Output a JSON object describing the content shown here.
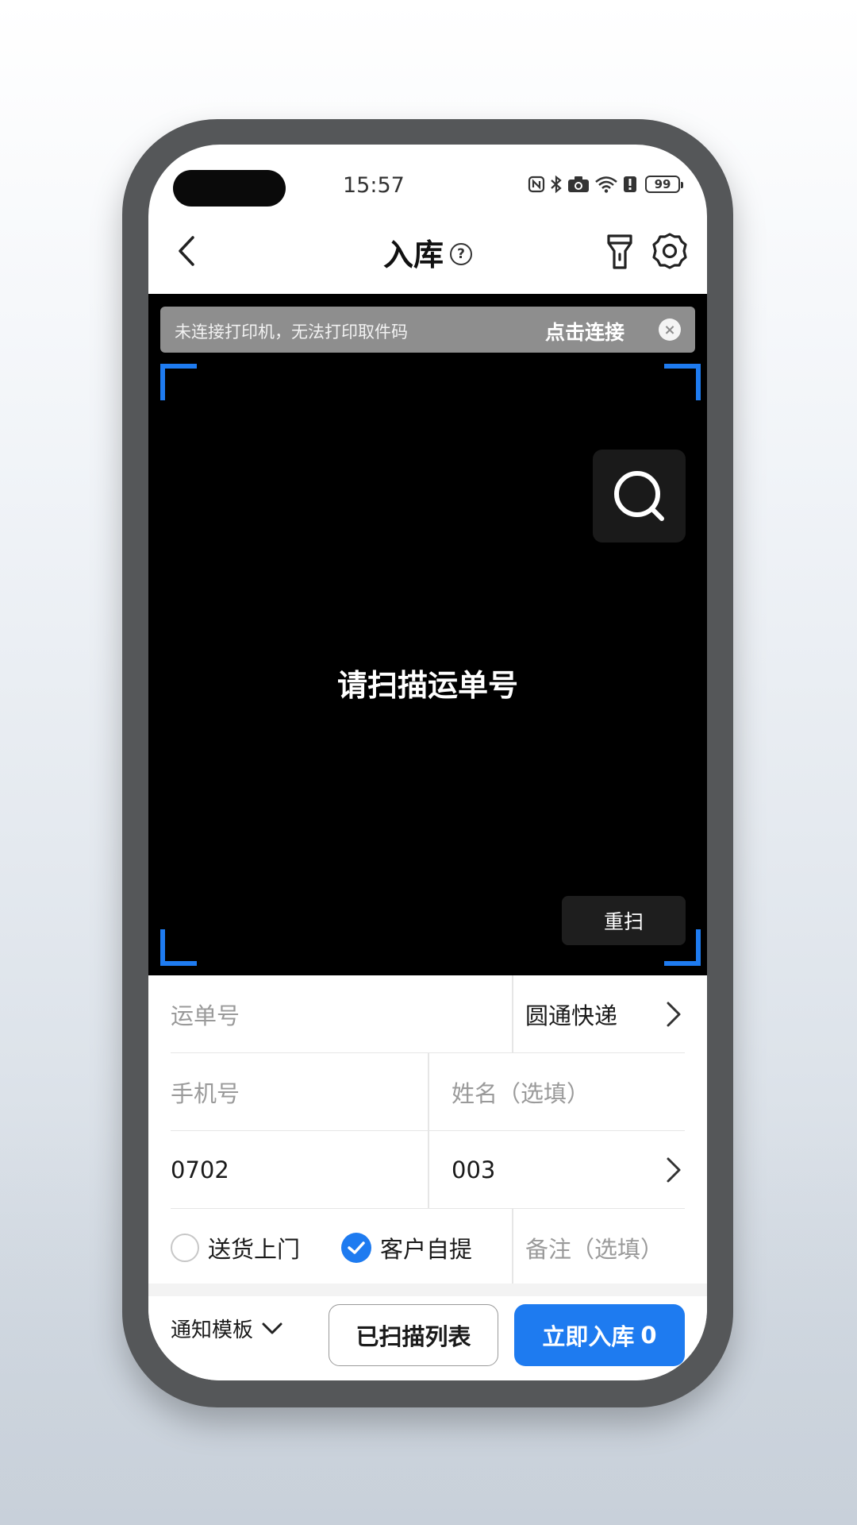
{
  "status_bar": {
    "time": "15:57",
    "battery": "99"
  },
  "nav": {
    "title": "入库",
    "help_glyph": "?"
  },
  "banner": {
    "message": "未连接打印机，无法打印取件码",
    "connect_label": "点击连接",
    "close_glyph": "×"
  },
  "scanner": {
    "prompt": "请扫描运单号",
    "rescan_label": "重扫"
  },
  "form": {
    "tracking_placeholder": "运单号",
    "courier": "圆通快递",
    "phone_placeholder": "手机号",
    "name_placeholder": "姓名（选填）",
    "phone_suffix": "0702",
    "code": "003",
    "delivery_options": [
      {
        "label": "送货上门",
        "checked": false
      },
      {
        "label": "客户自提",
        "checked": true
      }
    ],
    "remark_placeholder": "备注（选填）"
  },
  "bottom": {
    "template_label": "通知模板",
    "scanned_list_label": "已扫描列表",
    "submit_label": "立即入库",
    "submit_count": "0"
  },
  "colors": {
    "accent": "#1e7bf0",
    "camera_bg": "#000000",
    "banner_bg": "#8e8e8e"
  },
  "icons": {
    "back": "back-arrow-icon",
    "help": "help-icon",
    "flash": "flashlight-icon",
    "settings": "gear-icon",
    "search": "search-icon",
    "close": "close-icon",
    "chevron": "chevron-right-icon",
    "dropdown": "chevron-down-icon",
    "check": "check-icon"
  }
}
